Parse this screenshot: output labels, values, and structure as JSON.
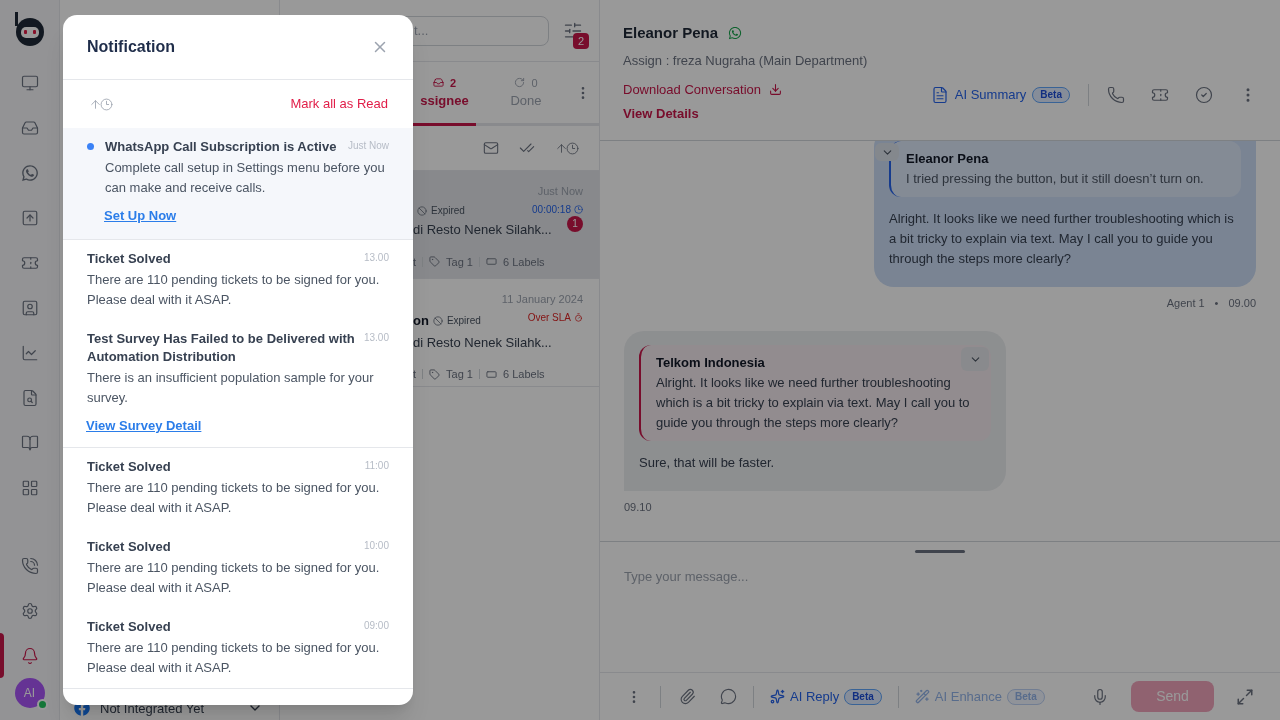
{
  "nav_items": [
    {
      "selected": false
    },
    {
      "selected": false
    },
    {
      "selected": false
    },
    {
      "selected": false
    },
    {
      "selected": false
    },
    {
      "selected": false
    },
    {
      "selected": false
    },
    {
      "selected": false
    },
    {
      "selected": false
    },
    {
      "selected": false
    },
    {
      "selected": false
    },
    {
      "selected": false
    },
    {
      "selected": true
    }
  ],
  "avatar": {
    "initials": "AI",
    "online": true
  },
  "channel_panel": {
    "status": "Not Integrated Yet"
  },
  "conversation_list": {
    "search_placeholder": "t...",
    "filter_count": "2",
    "tabs": [
      {
        "label": "ssignee",
        "count": "2",
        "selected": true
      },
      {
        "label": "Done",
        "count": "0",
        "selected": false
      }
    ],
    "rows": [
      {
        "selected": true,
        "name": "",
        "status": "Expired",
        "time": "Just Now",
        "over_sla": false,
        "sla": "00:00:18",
        "preview": "di Resto Nenek Silahk...",
        "unread": "1",
        "channel": "t",
        "tag": "Tag 1",
        "labels": "6 Labels"
      },
      {
        "selected": false,
        "name": "on",
        "status": "Expired",
        "time": "11 January 2024",
        "over_sla": true,
        "sla": "Over SLA",
        "preview": "di Resto Nenek Silahk...",
        "channel": "t",
        "tag": "Tag 1",
        "labels": "6 Labels"
      }
    ]
  },
  "chat": {
    "name": "Eleanor Pena",
    "assign": "Assign : freza Nugraha (Main Department)",
    "download": "Download Conversation",
    "view_details": "View Details",
    "ai_summary": "AI Summary",
    "ai_summary_badge": "Beta",
    "messages": [
      {
        "kind": "outgoing",
        "quote_author": "Eleanor Pena",
        "quote_text": "I tried pressing the button, but it still doesn’t turn on.",
        "text": "Alright. It looks like we need further troubleshooting which is a bit tricky to explain via text. May I call you to guide you through the steps more clearly?",
        "sender": "Agent 1",
        "separator": "•",
        "time": "09.00"
      },
      {
        "kind": "incoming",
        "quote_author": "Telkom Indonesia",
        "quote_text": "Alright. It looks like we need further troubleshooting which is a bit tricky to explain via text. May I call you to guide you through the steps more clearly?",
        "text": "Sure, that will be faster.",
        "time": "09.10"
      }
    ],
    "composer_placeholder": "Type your message...",
    "ai_reply": "AI Reply",
    "ai_reply_badge": "Beta",
    "ai_enhance": "AI Enhance",
    "ai_enhance_badge": "Beta",
    "send": "Send"
  },
  "notification": {
    "title": "Notification",
    "mark_all": "Mark all as Read",
    "sections": [
      {
        "items": [
          {
            "unread": true,
            "title": "WhatsApp Call Subscription is Active",
            "time": "Just Now",
            "body": "Complete call setup in Settings menu before you can make and receive calls.",
            "link": "Set Up Now"
          }
        ]
      },
      {
        "items": [
          {
            "unread": false,
            "title": "Ticket Solved",
            "time": "13.00",
            "body": "There are 110 pending tickets to be signed for you. Please deal with it ASAP."
          },
          {
            "unread": false,
            "title": "Test Survey Has Failed to be Delivered with Automation Distribution",
            "time": "13.00",
            "body": "There is an insufficient population sample for your survey.",
            "link": "View Survey Detail"
          }
        ]
      },
      {
        "items": [
          {
            "unread": false,
            "title": "Ticket Solved",
            "time": "11:00",
            "body": "There are 110 pending tickets to be signed for you. Please deal with it ASAP."
          },
          {
            "unread": false,
            "title": "Ticket Solved",
            "time": "10:00",
            "body": "There are 110 pending tickets to be signed for you. Please deal with it ASAP."
          },
          {
            "unread": false,
            "title": "Ticket Solved",
            "time": "09:00",
            "body": "There are 110 pending tickets to be signed for you. Please deal with it ASAP."
          }
        ]
      }
    ]
  }
}
